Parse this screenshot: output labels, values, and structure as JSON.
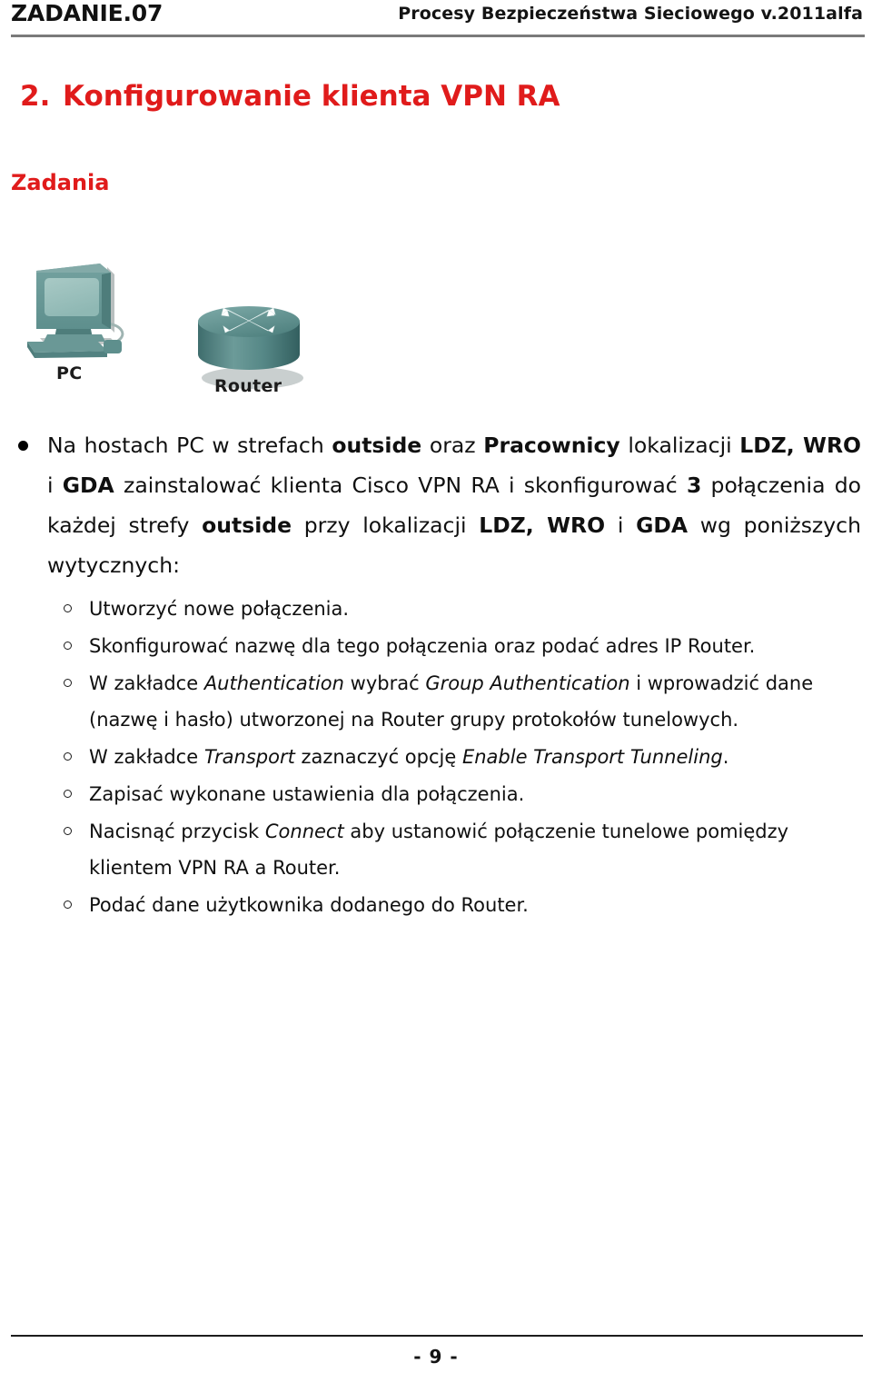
{
  "header": {
    "left_label": "ZADANIE.07",
    "right_label": "Procesy Bezpieczeństwa Sieciowego  v.2011alfa"
  },
  "title": {
    "number": "2.",
    "text": "Konfigurowanie klienta VPN RA",
    "color": "#E01B1B"
  },
  "subtitle": {
    "text": "Zadania",
    "color": "#E01B1B"
  },
  "figure": {
    "pc_caption": "PC",
    "router_caption": "Router",
    "icon_color": "#5f9090"
  },
  "main_bullet": {
    "marker": "disc-bullet",
    "parts": [
      {
        "text": "Na hostach PC w strefach ",
        "bold": false
      },
      {
        "text": "outside",
        "bold": true
      },
      {
        "text": " oraz ",
        "bold": false
      },
      {
        "text": "Pracownicy",
        "bold": true
      },
      {
        "text": " lokalizacji ",
        "bold": false
      },
      {
        "text": "LDZ, WRO",
        "bold": true
      },
      {
        "text": " i ",
        "bold": false
      },
      {
        "text": "GDA",
        "bold": true
      },
      {
        "text": " zainstalować klienta Cisco VPN RA i skonfigurować ",
        "bold": false
      },
      {
        "text": "3",
        "bold": true
      },
      {
        "text": " połączenia do każdej strefy ",
        "bold": false
      },
      {
        "text": "outside",
        "bold": true
      },
      {
        "text": " przy lokalizacji ",
        "bold": false
      },
      {
        "text": "LDZ, WRO",
        "bold": true
      },
      {
        "text": " i ",
        "bold": false
      },
      {
        "text": "GDA",
        "bold": true
      },
      {
        "text": " wg poniższych wytycznych:",
        "bold": false
      }
    ]
  },
  "sub_bullets": {
    "marker": "circle-bullet",
    "items": [
      {
        "parts": [
          {
            "text": "Utworzyć nowe połączenia.",
            "italic": false
          }
        ]
      },
      {
        "parts": [
          {
            "text": "Skonfigurować nazwę dla tego połączenia oraz podać adres IP Router.",
            "italic": false
          }
        ]
      },
      {
        "parts": [
          {
            "text": "W zakładce ",
            "italic": false
          },
          {
            "text": "Authentication",
            "italic": true
          },
          {
            "text": " wybrać ",
            "italic": false
          },
          {
            "text": "Group Authentication",
            "italic": true
          },
          {
            "text": " i wprowadzić dane (nazwę i hasło) utworzonej na Router grupy protokołów tunelowych.",
            "italic": false
          }
        ]
      },
      {
        "parts": [
          {
            "text": "W zakładce ",
            "italic": false
          },
          {
            "text": "Transport",
            "italic": true
          },
          {
            "text": " zaznaczyć opcję ",
            "italic": false
          },
          {
            "text": "Enable Transport Tunneling",
            "italic": true
          },
          {
            "text": ".",
            "italic": false
          }
        ]
      },
      {
        "parts": [
          {
            "text": "Zapisać wykonane ustawienia dla połączenia.",
            "italic": false
          }
        ]
      },
      {
        "parts": [
          {
            "text": "Nacisnąć przycisk ",
            "italic": false
          },
          {
            "text": "Connect",
            "italic": true
          },
          {
            "text": " aby ustanowić połączenie tunelowe pomiędzy klientem VPN RA a Router.",
            "italic": false
          }
        ]
      },
      {
        "parts": [
          {
            "text": "Podać dane użytkownika dodanego do Router.",
            "italic": false
          }
        ]
      }
    ]
  },
  "footer": {
    "page_label": "- 9 -"
  }
}
